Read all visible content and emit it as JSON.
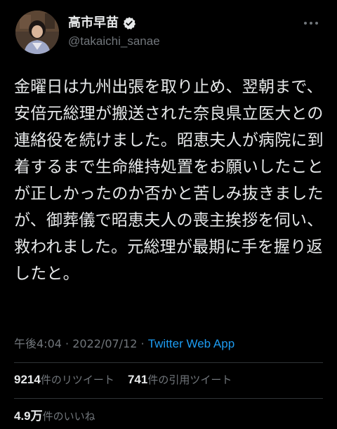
{
  "user": {
    "display_name": "高市早苗",
    "handle": "@takaichi_sanae",
    "verified": true
  },
  "tweet": {
    "text": "金曜日は九州出張を取り止め、翌朝まで、安倍元総理が搬送された奈良県立医大との連絡役を続けました。昭恵夫人が病院に到着するまで生命維持処置をお願いしたことが正しかったのか否かと苦しみ抜きましたが、御葬儀で昭恵夫人の喪主挨拶を伺い、救われました。元総理が最期に手を握り返したと。",
    "time": "午後4:04",
    "separator": " · ",
    "date": "2022/07/12",
    "source": "Twitter Web App"
  },
  "stats": {
    "retweets_count": "9214",
    "retweets_label": "件のリツイート",
    "quotes_count": "741",
    "quotes_label": "件の引用ツイート",
    "likes_count": "4.9万",
    "likes_label": "件のいいね"
  },
  "icons": {
    "verified": "verified-badge-icon",
    "more": "more-options-icon"
  },
  "colors": {
    "background": "#000000",
    "text": "#e7e9ea",
    "muted": "#71767b",
    "link": "#1d9bf0",
    "divider": "#2f3336"
  }
}
